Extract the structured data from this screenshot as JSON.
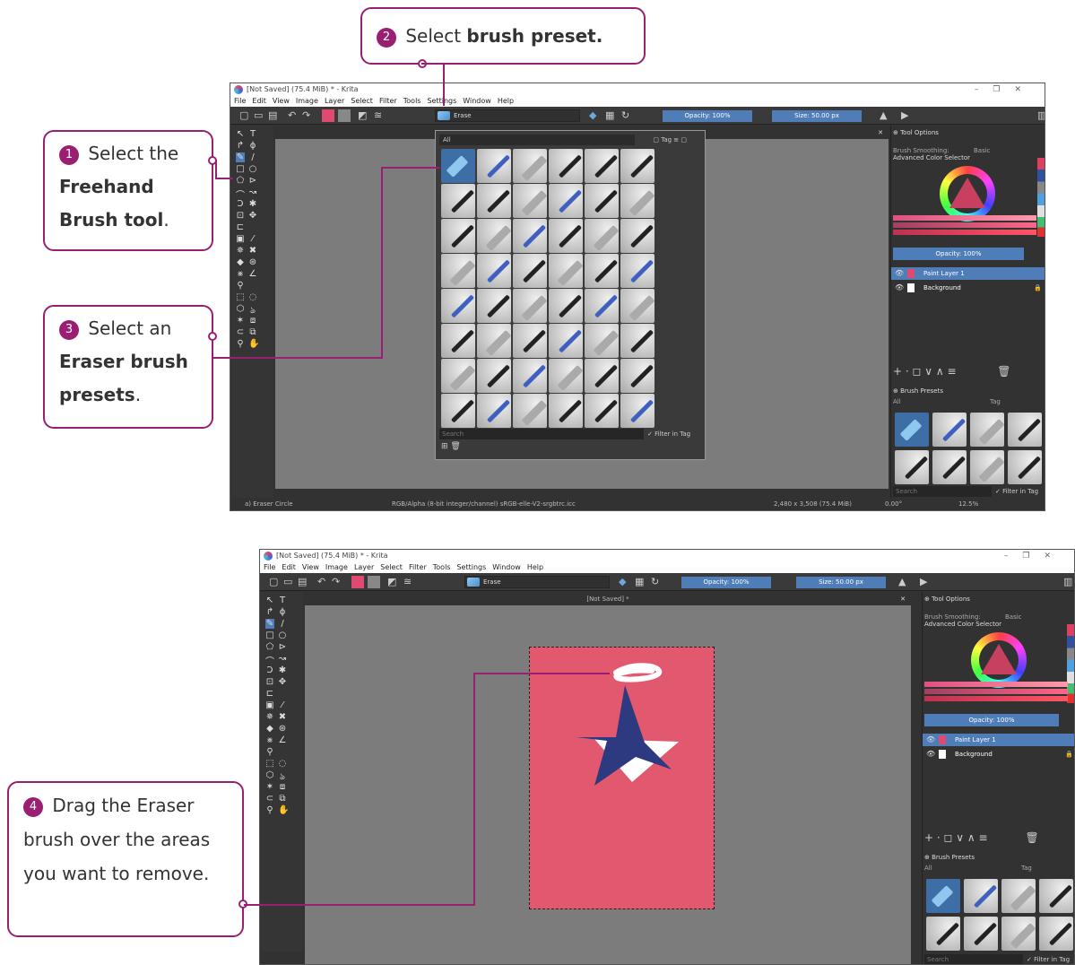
{
  "callouts": {
    "c1": {
      "num": "1",
      "pre": "Select the",
      "bold": "Freehand Brush tool",
      "post": "."
    },
    "c2": {
      "num": "2",
      "pre": "Select",
      "bold": "brush preset."
    },
    "c3": {
      "num": "3",
      "pre": "Select an",
      "bold": "Eraser brush presets",
      "post": "."
    },
    "c4": {
      "num": "4",
      "text": "Drag the Eraser brush over the areas you want to remove."
    }
  },
  "window1": {
    "title": "[Not Saved]  (75.4 MiB)  * - Krita",
    "menus": [
      "File",
      "Edit",
      "View",
      "Image",
      "Layer",
      "Select",
      "Filter",
      "Tools",
      "Settings",
      "Window",
      "Help"
    ],
    "brush_name": "Erase",
    "opacity": "Opacity: 100%",
    "size": "Size: 50.00 px",
    "tool_options": "Tool Options",
    "brush_smoothing": "Brush Smoothing:",
    "smoothing_value": "Basic",
    "color_selector": "Advanced Color Selector",
    "layers_opacity": "Opacity:  100%",
    "layers": [
      "Paint Layer 1",
      "Background"
    ],
    "brush_presets": "Brush Presets",
    "all": "All",
    "tag": "Tag",
    "search": "Search",
    "filter_in_tag": "Filter in Tag",
    "status_left": "a) Eraser Circle",
    "status_mid": "RGB/Alpha (8-bit integer/channel)  sRGB-elle-V2-srgbtrc.icc",
    "status_size": "2,480 x 3,508 (75.4 MiB)",
    "status_rot": "0.00°",
    "status_zoom": "12.5%"
  },
  "window2": {
    "title": "[Not Saved]  (75.4 MiB)  * - Krita",
    "doc_tab": "[Not Saved] *",
    "brush_name": "Erase",
    "opacity": "Opacity: 100%",
    "size": "Size: 50.00 px",
    "tool_options": "Tool Options",
    "brush_smoothing": "Brush Smoothing:",
    "smoothing_value": "Basic",
    "color_selector": "Advanced Color Selector",
    "layers_opacity": "Opacity:  100%",
    "layers": [
      "Paint Layer 1",
      "Background"
    ],
    "brush_presets": "Brush Presets",
    "all": "All",
    "tag": "Tag",
    "search": "Search",
    "filter_in_tag": "Filter in Tag"
  },
  "colors": {
    "accent": "#9a1e72",
    "canvas_pink": "#e2586e",
    "star_navy": "#2e3a80",
    "krita_blue": "#4f7db8"
  }
}
